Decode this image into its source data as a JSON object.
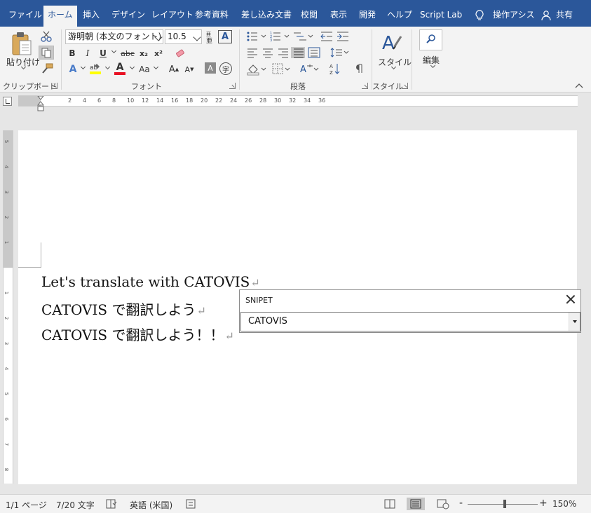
{
  "tabs": [
    {
      "label": "ファイル"
    },
    {
      "label": "ホーム"
    },
    {
      "label": "挿入"
    },
    {
      "label": "デザイン"
    },
    {
      "label": "レイアウト"
    },
    {
      "label": "参考資料"
    },
    {
      "label": "差し込み文書"
    },
    {
      "label": "校閲"
    },
    {
      "label": "表示"
    },
    {
      "label": "開発"
    },
    {
      "label": "ヘルプ"
    },
    {
      "label": "Script Lab"
    },
    {
      "label": "操作アシス"
    },
    {
      "label": "共有"
    }
  ],
  "ribbon": {
    "paste_label": "貼り付け",
    "font_name": "游明朝 (本文のフォント)",
    "font_size": "10.5",
    "style_label": "スタイル",
    "edit_label": "編集",
    "groups": {
      "clipboard": "クリップボード",
      "font": "フォント",
      "paragraph": "段落",
      "style": "スタイル"
    },
    "buttons": {
      "bold": "B",
      "italic": "I",
      "underline": "U",
      "strike": "abc",
      "subscript": "x₂",
      "superscript": "x²",
      "grow": "A",
      "shrink": "A",
      "case": "Aa",
      "text_effect": "A",
      "font_color": "A",
      "char_shade": "A",
      "enclose": "字"
    }
  },
  "ruler": {
    "h_ticks": [
      "2",
      "4",
      "6",
      "8",
      "10",
      "12",
      "14",
      "16",
      "18",
      "20",
      "22",
      "24",
      "26",
      "28",
      "30",
      "32",
      "34",
      "36"
    ],
    "v_ticks_top": [
      "5",
      "4",
      "3",
      "2",
      "1"
    ],
    "v_ticks_bottom": [
      "1",
      "2",
      "3",
      "4",
      "5",
      "6",
      "7",
      "8"
    ]
  },
  "document": {
    "lines": [
      "Let's translate with CATOVIS",
      "CATOVIS で翻訳しよう",
      "CATOVIS で翻訳しよう！！"
    ],
    "para_mark": "↵"
  },
  "snippet": {
    "title": "SNIPET",
    "value": "CATOVIS"
  },
  "status": {
    "page": "1/1 ページ",
    "words": "7/20 文字",
    "language": "英語 (米国)",
    "zoom": "150%",
    "zoom_minus": "-",
    "zoom_plus": "+"
  },
  "colors": {
    "brand": "#2b579a",
    "highlight": "#ffff00",
    "font_color": "#e81123"
  }
}
